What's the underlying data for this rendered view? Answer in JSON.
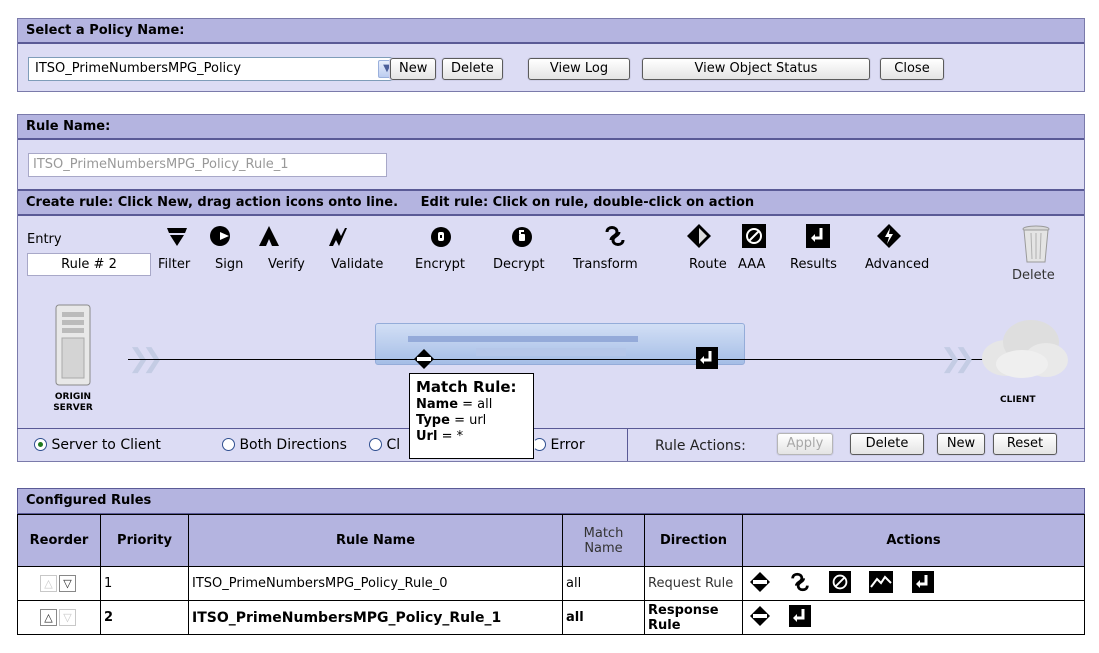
{
  "policy": {
    "header": "Select a Policy Name:",
    "selected": "ITSO_PrimeNumbersMPG_Policy",
    "buttons": {
      "new": "New",
      "delete": "Delete",
      "view_log": "View Log",
      "view_status": "View Object Status",
      "close": "Close"
    }
  },
  "rule": {
    "header": "Rule Name:",
    "name_value": "ITSO_PrimeNumbersMPG_Policy_Rule_1",
    "instructions": "Create rule: Click New, drag action icons onto line.     Edit rule: Click on rule, double-click on action",
    "entry_label": "Entry",
    "rule_number": "Rule # 2",
    "actions": [
      {
        "label": "Filter",
        "icon": "filter-icon"
      },
      {
        "label": "Sign",
        "icon": "sign-icon"
      },
      {
        "label": "Verify",
        "icon": "verify-icon"
      },
      {
        "label": "Validate",
        "icon": "validate-icon"
      },
      {
        "label": "Encrypt",
        "icon": "encrypt-icon"
      },
      {
        "label": "Decrypt",
        "icon": "decrypt-icon"
      },
      {
        "label": "Transform",
        "icon": "transform-icon"
      },
      {
        "label": "Route",
        "icon": "route-icon"
      },
      {
        "label": "AAA",
        "icon": "aaa-icon"
      },
      {
        "label": "Results",
        "icon": "results-icon"
      },
      {
        "label": "Advanced",
        "icon": "advanced-icon"
      }
    ],
    "delete_label": "Delete",
    "origin_label": "ORIGIN SERVER",
    "client_label": "CLIENT",
    "tooltip": {
      "title": "Match Rule:",
      "name_key": "Name",
      "name_val": "= all",
      "type_key": "Type",
      "type_val": "= url",
      "url_key": "Url",
      "url_val": "= *"
    },
    "directions": {
      "server_to_client": "Server to Client",
      "both": "Both Directions",
      "client_partial": "Cl",
      "error": "Error"
    },
    "rule_actions_label": "Rule Actions:",
    "rule_buttons": {
      "apply": "Apply",
      "delete": "Delete",
      "new": "New",
      "reset": "Reset"
    }
  },
  "configured": {
    "header": "Configured Rules",
    "columns": {
      "reorder": "Reorder",
      "priority": "Priority",
      "rule_name": "Rule Name",
      "match_name": "Match Name",
      "direction": "Direction",
      "actions": "Actions"
    },
    "rows": [
      {
        "priority": "1",
        "name": "ITSO_PrimeNumbersMPG_Policy_Rule_0",
        "match": "all",
        "direction": "Request Rule",
        "bold": false,
        "actions": [
          "match-icon",
          "transform-icon",
          "aaa-icon",
          "route-icon",
          "results-icon"
        ]
      },
      {
        "priority": "2",
        "name": "ITSO_PrimeNumbersMPG_Policy_Rule_1",
        "match": "all",
        "direction": "Response Rule",
        "bold": true,
        "actions": [
          "match-icon",
          "results-icon"
        ]
      }
    ]
  }
}
